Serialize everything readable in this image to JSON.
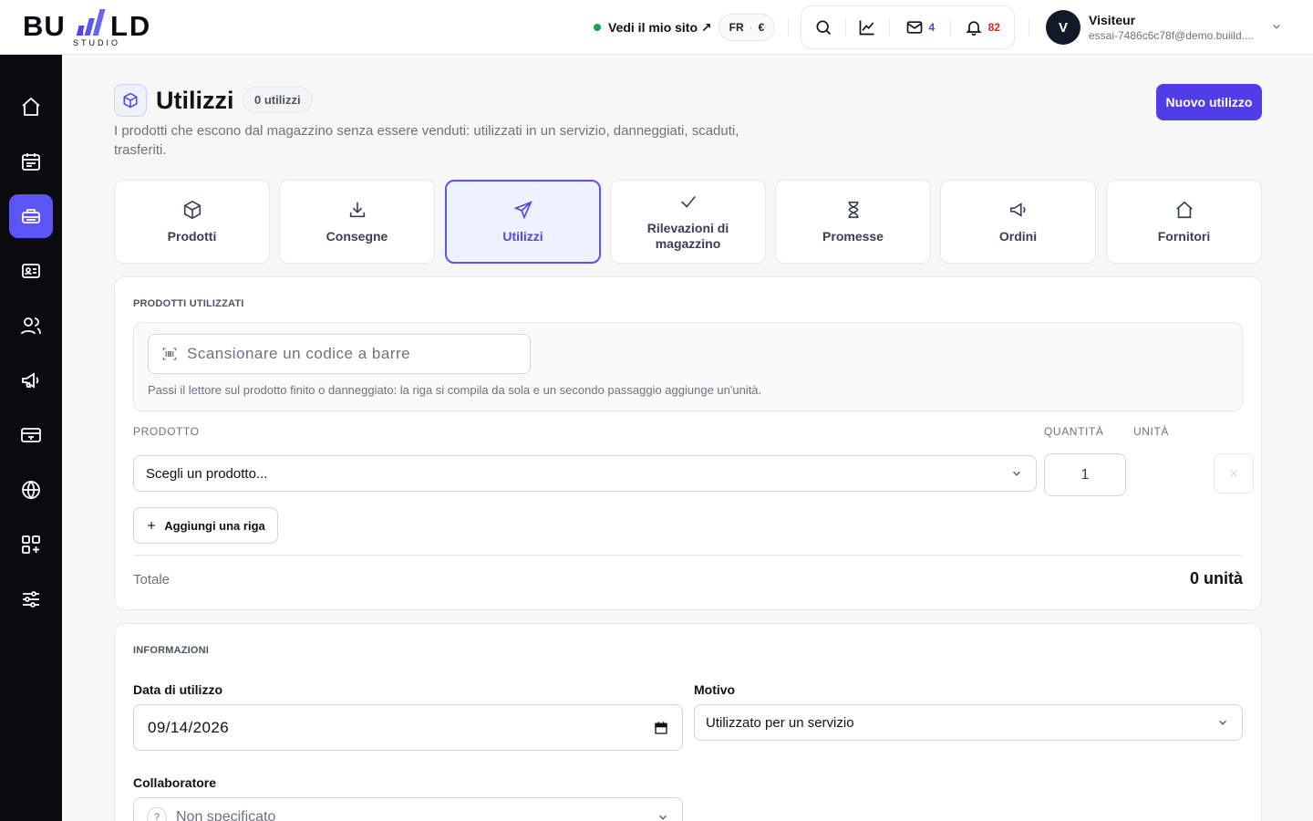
{
  "brand": {
    "logo_text": "BUILD",
    "logo_sub": "STUDIO"
  },
  "header": {
    "site_link": "Vedi il mio sito ↗",
    "lang": "FR",
    "currency": "€",
    "messages_count": "4",
    "notifications_count": "82",
    "user": {
      "initial": "V",
      "name": "Visiteur",
      "email": "essai-7486c6c78f@demo.buiild...."
    }
  },
  "sidebar": {
    "items": [
      {
        "icon": "home-icon"
      },
      {
        "icon": "calendar-icon"
      },
      {
        "icon": "inventory-icon",
        "active": true
      },
      {
        "icon": "contact-card-icon"
      },
      {
        "icon": "users-icon"
      },
      {
        "icon": "megaphone-icon"
      },
      {
        "icon": "payment-icon"
      },
      {
        "icon": "globe-icon"
      },
      {
        "icon": "apps-add-icon"
      },
      {
        "icon": "settings-sliders-icon"
      }
    ]
  },
  "page": {
    "title": "Utilizzi",
    "count_badge": "0 utilizzi",
    "description": "I prodotti che escono dal magazzino senza essere venduti: utilizzati in un servizio, danneggiati, scaduti, trasferiti.",
    "new_button": "Nuovo utilizzo"
  },
  "tabs": [
    {
      "label": "Prodotti",
      "icon": "box-icon"
    },
    {
      "label": "Consegne",
      "icon": "download-icon"
    },
    {
      "label": "Utilizzi",
      "icon": "send-icon",
      "active": true
    },
    {
      "label": "Rilevazioni di magazzino",
      "icon": "check-icon"
    },
    {
      "label": "Promesse",
      "icon": "hourglass-icon"
    },
    {
      "label": "Ordini",
      "icon": "megaphone-icon"
    },
    {
      "label": "Fornitori",
      "icon": "house-icon"
    }
  ],
  "products_card": {
    "title": "PRODOTTI UTILIZZATI",
    "scan_placeholder": "Scansionare un codice a barre",
    "scan_hint": "Passi il lettore sul prodotto finito o danneggiato: la riga si compila da sola e un secondo passaggio aggiunge un'unità.",
    "col_product": "PRODOTTO",
    "col_quantity": "QUANTITÀ",
    "col_unit": "UNITÀ",
    "product_select": "Scegli un prodotto...",
    "quantity_value": "1",
    "add_row": "Aggiungi una riga",
    "total_label": "Totale",
    "total_value": "0 unità"
  },
  "info_card": {
    "title": "INFORMAZIONI",
    "date_label": "Data di utilizzo",
    "date_value": "09/14/2026",
    "reason_label": "Motivo",
    "reason_value": "Utilizzato per un servizio",
    "collaborator_label": "Collaboratore",
    "collaborator_value": "Non specificato"
  },
  "colors": {
    "accent": "#4f3de8",
    "sidebar": "#0b0b0f",
    "active_nav": "#5b55f5"
  }
}
